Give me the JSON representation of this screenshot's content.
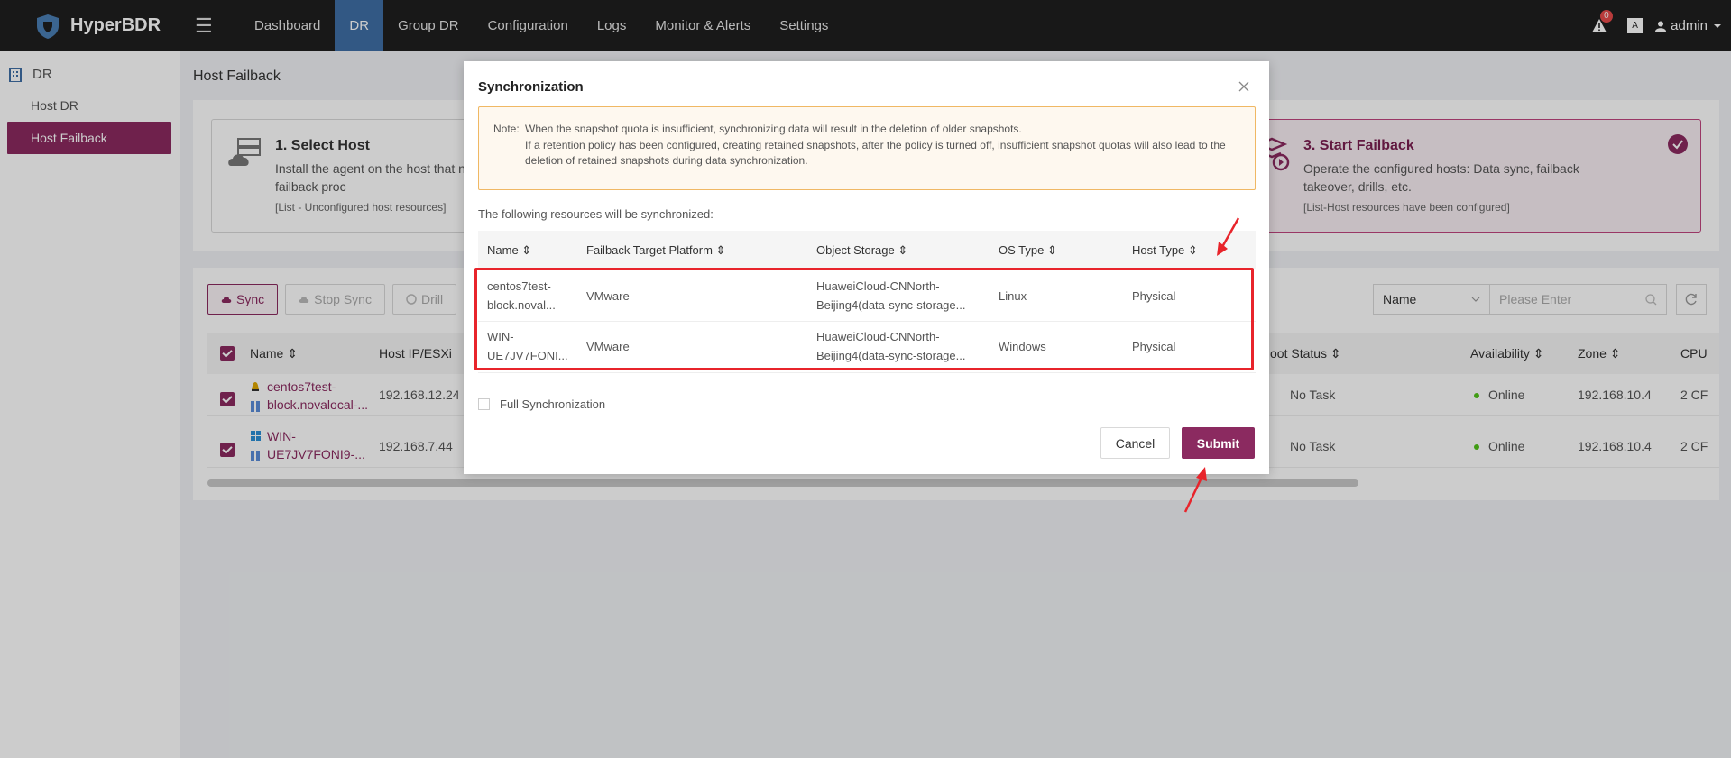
{
  "app": {
    "name": "HyperBDR"
  },
  "nav": {
    "items": [
      "Dashboard",
      "DR",
      "Group DR",
      "Configuration",
      "Logs",
      "Monitor & Alerts",
      "Settings"
    ],
    "active": "DR"
  },
  "topright": {
    "alert_count": "0",
    "lang_label": "A",
    "user": "admin"
  },
  "sidebar": {
    "group": "DR",
    "items": [
      {
        "label": "Host DR",
        "active": false
      },
      {
        "label": "Host Failback",
        "active": true
      }
    ]
  },
  "page": {
    "title": "Host Failback"
  },
  "steps": [
    {
      "title": "1. Select Host",
      "desc": "Install the agent on the host that n and register it in the failback proc",
      "sub": "[List - Unconfigured host resources]"
    },
    {
      "title": "3. Start Failback",
      "desc": "Operate the configured hosts: Data sync, failback takeover, drills, etc.",
      "sub": "[List-Host resources have been configured]"
    }
  ],
  "toolbar": {
    "sync": "Sync",
    "stop_sync": "Stop Sync",
    "drill": "Drill"
  },
  "search": {
    "field": "Name",
    "placeholder": "Please Enter"
  },
  "table": {
    "headers": {
      "name": "Name",
      "ip": "Host IP/ESXi",
      "boot_status": "oot Status",
      "availability": "Availability",
      "zone": "Zone",
      "cpu": "CPU"
    },
    "rows": [
      {
        "name_line1": "centos7test-",
        "name_line2": "block.novalocal-...",
        "ip": "192.168.12.24",
        "boot_status": "No Task",
        "availability": "Online",
        "zone": "192.168.10.4",
        "cpu": "2 CF"
      },
      {
        "name_line1": "WIN-",
        "name_line2": "UE7JV7FONI9-...",
        "ip": "192.168.7.44",
        "boot_status": "No Task",
        "availability": "Online",
        "zone": "192.168.10.4",
        "cpu": "2 CF"
      }
    ]
  },
  "modal": {
    "title": "Synchronization",
    "note_label": "Note:",
    "note_lines": [
      "When the snapshot quota is insufficient, synchronizing data will result in the deletion of older snapshots.",
      "If a retention policy has been configured, creating retained snapshots, after the policy is turned off, insufficient snapshot quotas will also lead to the deletion of retained snapshots during data synchronization."
    ],
    "following": "The following resources will be synchronized:",
    "headers": {
      "name": "Name",
      "platform": "Failback Target Platform",
      "storage": "Object Storage",
      "os": "OS Type",
      "host_type": "Host Type"
    },
    "rows": [
      {
        "name_line1": "centos7test-",
        "name_line2": "block.noval...",
        "platform": "VMware",
        "storage_line1": "HuaweiCloud-CNNorth-",
        "storage_line2": "Beijing4(data-sync-storage...",
        "os": "Linux",
        "host_type": "Physical"
      },
      {
        "name_line1": "WIN-",
        "name_line2": "UE7JV7FONI...",
        "platform": "VMware",
        "storage_line1": "HuaweiCloud-CNNorth-",
        "storage_line2": "Beijing4(data-sync-storage...",
        "os": "Windows",
        "host_type": "Physical"
      }
    ],
    "full_sync": "Full Synchronization",
    "cancel": "Cancel",
    "submit": "Submit"
  },
  "colors": {
    "brand": "#8b2a60",
    "nav_active": "#3f6ea6",
    "topbar": "#1f1f1f",
    "annotation": "#e8242b"
  }
}
